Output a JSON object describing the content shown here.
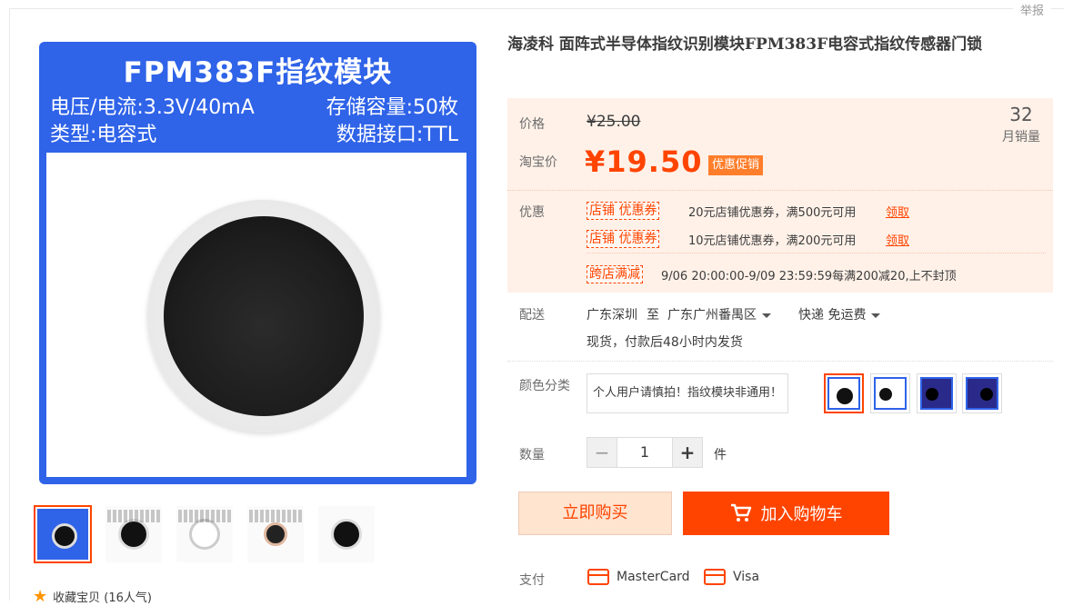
{
  "header": {
    "report": "举报"
  },
  "product": {
    "title": "海凌科 面阵式半导体指纹识别模块FPM383F电容式指纹传感器门锁",
    "image": {
      "title": "FPM383F指纹模块",
      "spec_voltage": "电压/电流:3.3V/40mA",
      "spec_storage": "存储容量:50枚",
      "spec_type": "类型:电容式",
      "spec_interface": "数据接口:TTL"
    }
  },
  "price": {
    "label": "价格",
    "old": "¥25.00",
    "taobao_label": "淘宝价",
    "current": "¥19.50",
    "promo_badge": "优惠促销",
    "sales_num": "32",
    "sales_label": "月销量"
  },
  "promo": {
    "label": "优惠",
    "coupons": [
      {
        "tag": "店铺 优惠券",
        "text": "20元店铺优惠券，满500元可用",
        "claim": "领取"
      },
      {
        "tag": "店铺 优惠券",
        "text": "10元店铺优惠券，满200元可用",
        "claim": "领取"
      }
    ],
    "cross": {
      "tag": "跨店满减",
      "text": "9/06 20:00:00-9/09 23:59:59每满200减20,上不封顶"
    }
  },
  "shipping": {
    "label": "配送",
    "from": "广东深圳",
    "to_word": "至",
    "to": "广东广州番禺区",
    "method": "快递 免运费",
    "note": "现货，付款后48小时内发货"
  },
  "sku": {
    "label": "颜色分类",
    "text_option": "个人用户请慎拍！指纹模块非通用！"
  },
  "quantity": {
    "label": "数量",
    "value": "1",
    "unit": "件",
    "minus": "−",
    "plus": "+"
  },
  "actions": {
    "buy_now": "立即购买",
    "add_cart": "加入购物车"
  },
  "payment": {
    "label": "支付",
    "methods": [
      "MasterCard",
      "Visa"
    ]
  },
  "favorite": {
    "text": "收藏宝贝 (16人气)"
  },
  "colors": {
    "accent": "#ff4400",
    "brand_blue": "#2f63e8",
    "price_bg": "#fff1e8"
  }
}
